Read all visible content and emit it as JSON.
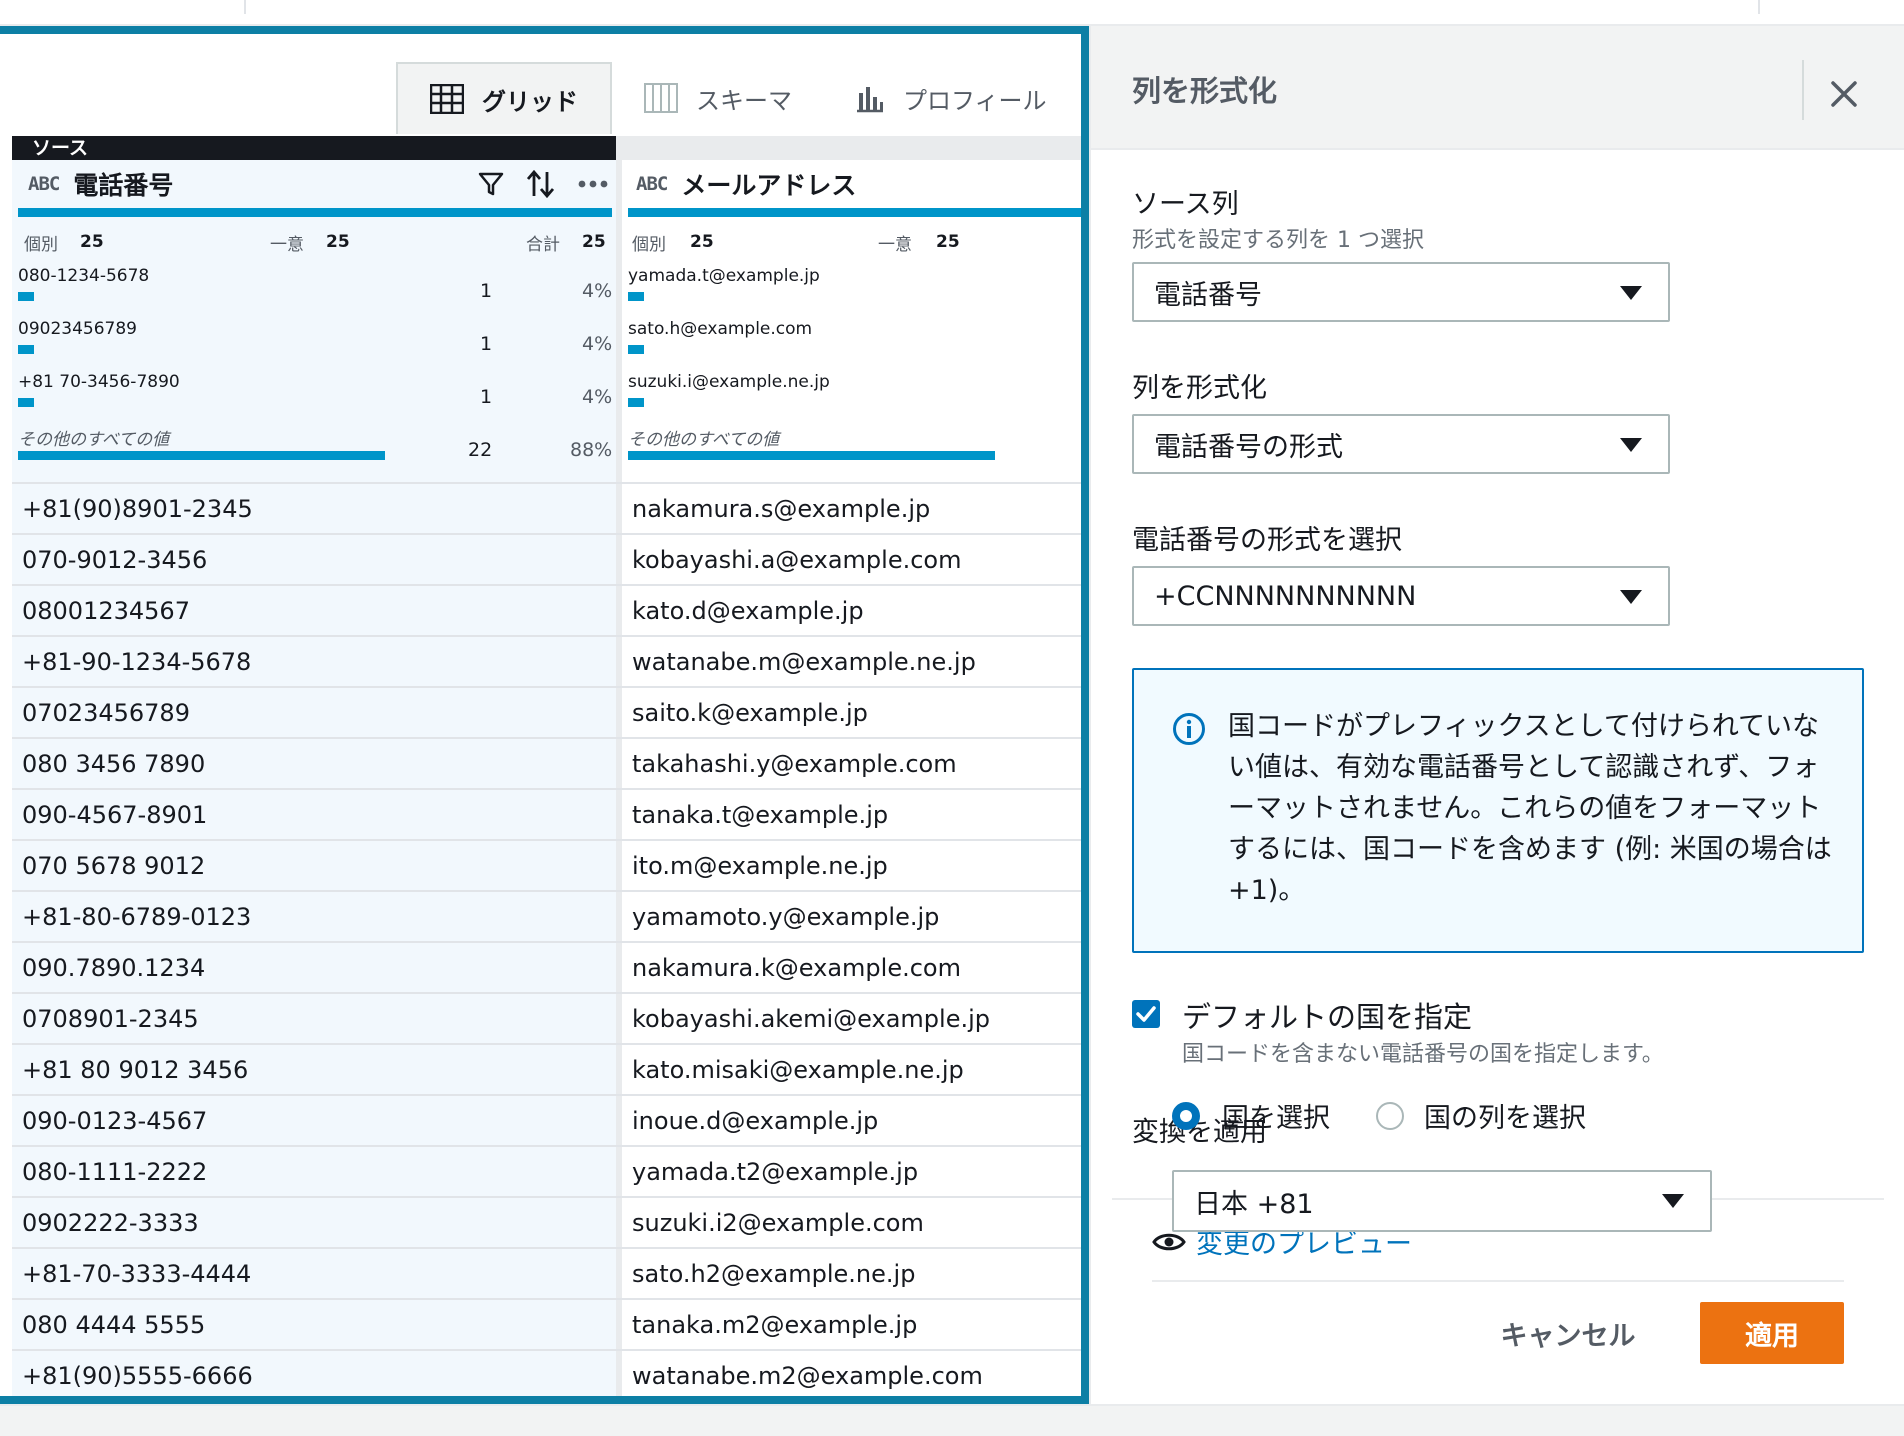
{
  "view_tabs": {
    "grid": "グリッド",
    "schema": "スキーマ",
    "profile": "プロフィール"
  },
  "source_badge": "ソース",
  "column_type": "ABC",
  "columns": [
    {
      "name": "電話番号",
      "stats": {
        "distinct_label": "個別",
        "distinct": "25",
        "unique_label": "一意",
        "unique": "25",
        "total_label": "合計",
        "total": "25"
      },
      "top_values": [
        {
          "value": "080-1234-5678",
          "count": "1",
          "pct": "4%"
        },
        {
          "value": "09023456789",
          "count": "1",
          "pct": "4%"
        },
        {
          "value": "+81 70-3456-7890",
          "count": "1",
          "pct": "4%"
        }
      ],
      "other": {
        "label": "その他のすべての値",
        "count": "22",
        "pct": "88%"
      }
    },
    {
      "name": "メールアドレス",
      "stats": {
        "distinct_label": "個別",
        "distinct": "25",
        "unique_label": "一意",
        "unique": "25"
      },
      "top_values": [
        {
          "value": "yamada.t@example.jp"
        },
        {
          "value": "sato.h@example.com"
        },
        {
          "value": "suzuki.i@example.ne.jp"
        }
      ],
      "other": {
        "label": "その他のすべての値"
      }
    }
  ],
  "rows": [
    [
      "+81(90)8901-2345",
      "nakamura.s@example.jp"
    ],
    [
      "070-9012-3456",
      "kobayashi.a@example.com"
    ],
    [
      "08001234567",
      "kato.d@example.jp"
    ],
    [
      "+81-90-1234-5678",
      "watanabe.m@example.ne.jp"
    ],
    [
      "07023456789",
      "saito.k@example.jp"
    ],
    [
      "080 3456 7890",
      "takahashi.y@example.com"
    ],
    [
      "090-4567-8901",
      "tanaka.t@example.jp"
    ],
    [
      "070 5678 9012",
      "ito.m@example.ne.jp"
    ],
    [
      "+81-80-6789-0123",
      "yamamoto.y@example.jp"
    ],
    [
      "090.7890.1234",
      "nakamura.k@example.com"
    ],
    [
      "0708901-2345",
      "kobayashi.akemi@example.jp"
    ],
    [
      "+81 80 9012 3456",
      "kato.misaki@example.ne.jp"
    ],
    [
      "090-0123-4567",
      "inoue.d@example.jp"
    ],
    [
      "080-1111-2222",
      "yamada.t2@example.jp"
    ],
    [
      "0902222-3333",
      "suzuki.i2@example.com"
    ],
    [
      "+81-70-3333-4444",
      "sato.h2@example.ne.jp"
    ],
    [
      "080 4444 5555",
      "tanaka.m2@example.jp"
    ],
    [
      "+81(90)5555-6666",
      "watanabe.m2@example.com"
    ]
  ],
  "panel": {
    "title": "列を形式化",
    "source_column": {
      "label": "ソース列",
      "description": "形式を設定する列を 1 つ選択",
      "value": "電話番号"
    },
    "format_column": {
      "label": "列を形式化",
      "value": "電話番号の形式"
    },
    "phone_format": {
      "label": "電話番号の形式を選択",
      "value": "+CCNNNNNNNNNN"
    },
    "info": "国コードがプレフィックスとして付けられていない値は、有効な電話番号として認識されず、フォーマットされません。これらの値をフォーマットするには、国コードを含めます (例: 米国の場合は +1)。",
    "default_country": {
      "label": "デフォルトの国を指定",
      "description": "国コードを含まない電話番号の国を指定します。",
      "checked": true
    },
    "apply_transform_label": "変換を適用",
    "radio_options": [
      "国を選択",
      "国の列を選択"
    ],
    "country_value": "日本 +81",
    "preview_link": "変更のプレビュー",
    "cancel": "キャンセル",
    "apply": "適用"
  },
  "colors": {
    "accent": "#0073bb",
    "panel_border": "#0d7fa5",
    "bar": "#0095c9",
    "apply_button": "#ec7211"
  },
  "icons": [
    "grid-icon",
    "schema-icon",
    "profile-icon",
    "filter-icon",
    "sort-icon",
    "more-icon",
    "close-icon",
    "info-icon",
    "check-icon",
    "eye-icon"
  ]
}
